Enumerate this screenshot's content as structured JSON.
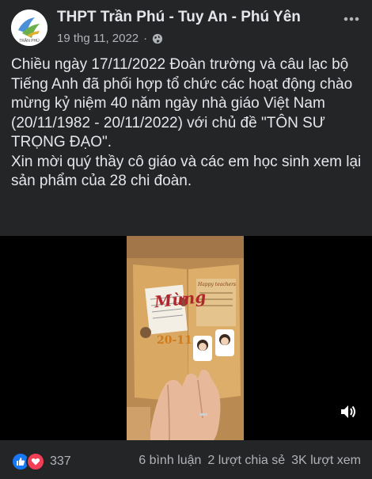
{
  "post": {
    "page_name": "THPT Trần Phú - Tuy An - Phú Yên",
    "date": "19 thg 11, 2022",
    "dot": "·",
    "privacy_icon": "globe-icon",
    "more_icon": "more-options-icon",
    "paragraphs": [
      "Chiều ngày 17/11/2022 Đoàn trường và câu lạc bộ Tiếng Anh đã phối hợp tổ chức các hoạt động chào mừng kỷ niệm 40 năm ngày nhà giáo Việt Nam (20/11/1982 - 20/11/2022) với chủ đề \"TÔN SƯ TRỌNG ĐẠO\".",
      "Xin mời quý thầy cô giáo và các em học sinh xem lại sản phẩm của 28 chi đoàn."
    ]
  },
  "video": {
    "card_title": "Mừng",
    "card_date": "20-11",
    "card_banner": "Happy teachers",
    "volume_icon": "volume-icon"
  },
  "footer": {
    "reaction_count": "337",
    "comments": "6 bình luận",
    "shares": "2 lượt chia sẻ",
    "views": "3K lượt xem"
  },
  "colors": {
    "background": "#242526",
    "text_primary": "#e4e6eb",
    "text_secondary": "#b0b3b8",
    "like_blue": "#1877f2",
    "love_red": "#f33e58"
  }
}
